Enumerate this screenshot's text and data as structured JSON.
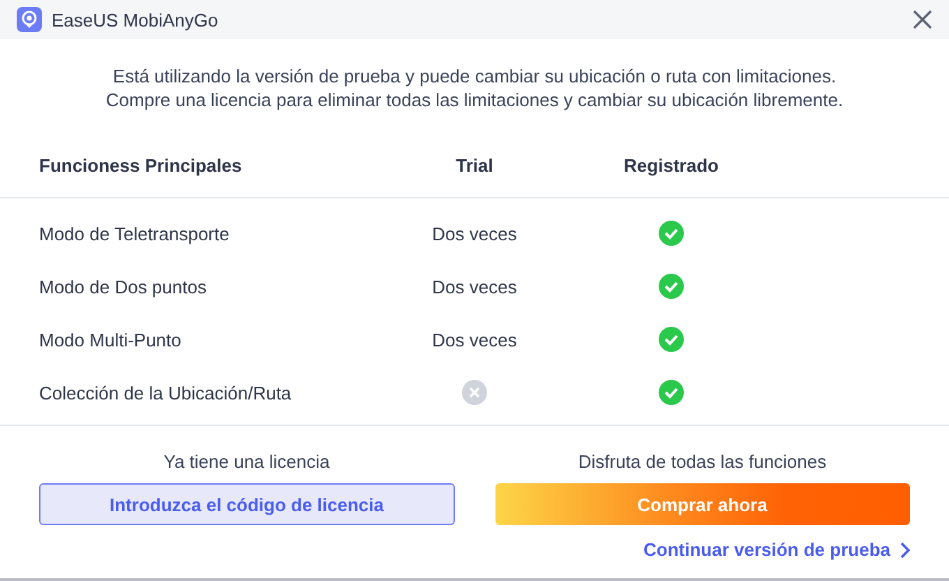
{
  "window": {
    "title": "EaseUS MobiAnyGo"
  },
  "message": [
    "Está utilizando la versión de prueba y puede cambiar su ubicación o ruta con limitaciones.",
    "Compre una licencia para eliminar todas las limitaciones y cambiar su ubicación libremente."
  ],
  "table": {
    "columns": [
      "Funcioness Principales",
      "Trial",
      "Registrado"
    ],
    "rows": [
      {
        "feature": "Modo de Teletransporte",
        "trial": {
          "kind": "text",
          "text": "Dos veces"
        },
        "registered": {
          "kind": "check"
        }
      },
      {
        "feature": "Modo de Dos puntos",
        "trial": {
          "kind": "text",
          "text": "Dos veces"
        },
        "registered": {
          "kind": "check"
        }
      },
      {
        "feature": "Modo Multi-Punto",
        "trial": {
          "kind": "text",
          "text": "Dos veces"
        },
        "registered": {
          "kind": "check"
        }
      },
      {
        "feature": "Colección de la Ubicación/Ruta",
        "trial": {
          "kind": "cross"
        },
        "registered": {
          "kind": "check"
        }
      }
    ]
  },
  "license": {
    "label": "Ya tiene una licencia",
    "button": "Introduzca el código de licencia"
  },
  "buy": {
    "label": "Disfruta de todas las funciones",
    "button": "Comprar ahora"
  },
  "continue_link": "Continuar versión de prueba"
}
